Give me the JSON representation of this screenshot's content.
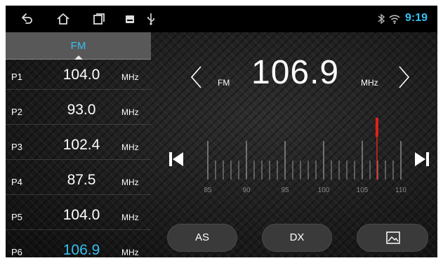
{
  "status_bar": {
    "time": "9:19",
    "icons": [
      "back-icon",
      "home-icon",
      "recent-apps-icon",
      "image-notification-icon",
      "usb-icon",
      "bluetooth-icon",
      "wifi-icon"
    ]
  },
  "band_tab": {
    "label": "FM"
  },
  "presets": [
    {
      "name": "P1",
      "freq": "104.0",
      "unit": "MHz",
      "active": false
    },
    {
      "name": "P2",
      "freq": "93.0",
      "unit": "MHz",
      "active": false
    },
    {
      "name": "P3",
      "freq": "102.4",
      "unit": "MHz",
      "active": false
    },
    {
      "name": "P4",
      "freq": "87.5",
      "unit": "MHz",
      "active": false
    },
    {
      "name": "P5",
      "freq": "104.0",
      "unit": "MHz",
      "active": false
    },
    {
      "name": "P6",
      "freq": "106.9",
      "unit": "MHz",
      "active": true
    }
  ],
  "tuner": {
    "band": "FM",
    "frequency": "106.9",
    "unit": "MHz",
    "dial_min": 85,
    "dial_max": 110,
    "dial_labels": [
      "85",
      "90",
      "95",
      "100",
      "105",
      "110"
    ],
    "current": 106.9
  },
  "buttons": {
    "as_label": "AS",
    "dx_label": "DX",
    "pic_icon": "picture-icon"
  },
  "colors": {
    "accent": "#36c0f0",
    "needle": "#e0221c"
  }
}
